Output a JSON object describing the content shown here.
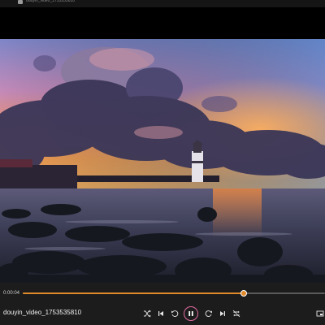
{
  "window": {
    "title": "douyin_video_1753535810",
    "app_icon": "media-player-icon"
  },
  "player": {
    "elapsed_time": "0:00:04",
    "total_time": "",
    "progress_fraction": 0.73,
    "state": "playing",
    "file_title": "douyin_video_1753535810"
  },
  "controls": {
    "shuffle_icon": "shuffle-icon",
    "previous_icon": "previous-track-icon",
    "rewind_icon": "rewind-10-icon",
    "pause_icon": "pause-icon",
    "forward_icon": "forward-30-icon",
    "next_icon": "next-track-icon",
    "repeat_icon": "repeat-icon",
    "miniplayer_icon": "miniplayer-icon"
  },
  "colors": {
    "accent": "#e08a2a",
    "play_ring": "#e06aa0",
    "control_bar": "#1c1c1c"
  }
}
